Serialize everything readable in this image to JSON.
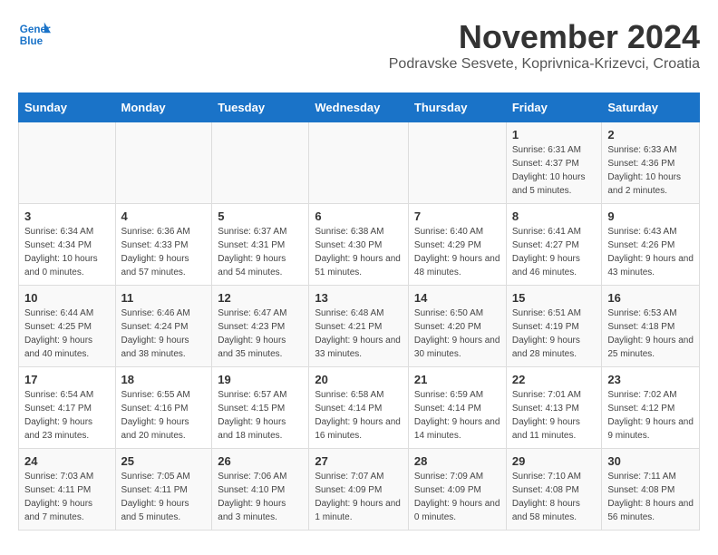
{
  "header": {
    "logo_line1": "General",
    "logo_line2": "Blue",
    "month_title": "November 2024",
    "location": "Podravske Sesvete, Koprivnica-Krizevci, Croatia"
  },
  "weekdays": [
    "Sunday",
    "Monday",
    "Tuesday",
    "Wednesday",
    "Thursday",
    "Friday",
    "Saturday"
  ],
  "weeks": [
    [
      {
        "day": "",
        "info": ""
      },
      {
        "day": "",
        "info": ""
      },
      {
        "day": "",
        "info": ""
      },
      {
        "day": "",
        "info": ""
      },
      {
        "day": "",
        "info": ""
      },
      {
        "day": "1",
        "info": "Sunrise: 6:31 AM\nSunset: 4:37 PM\nDaylight: 10 hours and 5 minutes."
      },
      {
        "day": "2",
        "info": "Sunrise: 6:33 AM\nSunset: 4:36 PM\nDaylight: 10 hours and 2 minutes."
      }
    ],
    [
      {
        "day": "3",
        "info": "Sunrise: 6:34 AM\nSunset: 4:34 PM\nDaylight: 10 hours and 0 minutes."
      },
      {
        "day": "4",
        "info": "Sunrise: 6:36 AM\nSunset: 4:33 PM\nDaylight: 9 hours and 57 minutes."
      },
      {
        "day": "5",
        "info": "Sunrise: 6:37 AM\nSunset: 4:31 PM\nDaylight: 9 hours and 54 minutes."
      },
      {
        "day": "6",
        "info": "Sunrise: 6:38 AM\nSunset: 4:30 PM\nDaylight: 9 hours and 51 minutes."
      },
      {
        "day": "7",
        "info": "Sunrise: 6:40 AM\nSunset: 4:29 PM\nDaylight: 9 hours and 48 minutes."
      },
      {
        "day": "8",
        "info": "Sunrise: 6:41 AM\nSunset: 4:27 PM\nDaylight: 9 hours and 46 minutes."
      },
      {
        "day": "9",
        "info": "Sunrise: 6:43 AM\nSunset: 4:26 PM\nDaylight: 9 hours and 43 minutes."
      }
    ],
    [
      {
        "day": "10",
        "info": "Sunrise: 6:44 AM\nSunset: 4:25 PM\nDaylight: 9 hours and 40 minutes."
      },
      {
        "day": "11",
        "info": "Sunrise: 6:46 AM\nSunset: 4:24 PM\nDaylight: 9 hours and 38 minutes."
      },
      {
        "day": "12",
        "info": "Sunrise: 6:47 AM\nSunset: 4:23 PM\nDaylight: 9 hours and 35 minutes."
      },
      {
        "day": "13",
        "info": "Sunrise: 6:48 AM\nSunset: 4:21 PM\nDaylight: 9 hours and 33 minutes."
      },
      {
        "day": "14",
        "info": "Sunrise: 6:50 AM\nSunset: 4:20 PM\nDaylight: 9 hours and 30 minutes."
      },
      {
        "day": "15",
        "info": "Sunrise: 6:51 AM\nSunset: 4:19 PM\nDaylight: 9 hours and 28 minutes."
      },
      {
        "day": "16",
        "info": "Sunrise: 6:53 AM\nSunset: 4:18 PM\nDaylight: 9 hours and 25 minutes."
      }
    ],
    [
      {
        "day": "17",
        "info": "Sunrise: 6:54 AM\nSunset: 4:17 PM\nDaylight: 9 hours and 23 minutes."
      },
      {
        "day": "18",
        "info": "Sunrise: 6:55 AM\nSunset: 4:16 PM\nDaylight: 9 hours and 20 minutes."
      },
      {
        "day": "19",
        "info": "Sunrise: 6:57 AM\nSunset: 4:15 PM\nDaylight: 9 hours and 18 minutes."
      },
      {
        "day": "20",
        "info": "Sunrise: 6:58 AM\nSunset: 4:14 PM\nDaylight: 9 hours and 16 minutes."
      },
      {
        "day": "21",
        "info": "Sunrise: 6:59 AM\nSunset: 4:14 PM\nDaylight: 9 hours and 14 minutes."
      },
      {
        "day": "22",
        "info": "Sunrise: 7:01 AM\nSunset: 4:13 PM\nDaylight: 9 hours and 11 minutes."
      },
      {
        "day": "23",
        "info": "Sunrise: 7:02 AM\nSunset: 4:12 PM\nDaylight: 9 hours and 9 minutes."
      }
    ],
    [
      {
        "day": "24",
        "info": "Sunrise: 7:03 AM\nSunset: 4:11 PM\nDaylight: 9 hours and 7 minutes."
      },
      {
        "day": "25",
        "info": "Sunrise: 7:05 AM\nSunset: 4:11 PM\nDaylight: 9 hours and 5 minutes."
      },
      {
        "day": "26",
        "info": "Sunrise: 7:06 AM\nSunset: 4:10 PM\nDaylight: 9 hours and 3 minutes."
      },
      {
        "day": "27",
        "info": "Sunrise: 7:07 AM\nSunset: 4:09 PM\nDaylight: 9 hours and 1 minute."
      },
      {
        "day": "28",
        "info": "Sunrise: 7:09 AM\nSunset: 4:09 PM\nDaylight: 9 hours and 0 minutes."
      },
      {
        "day": "29",
        "info": "Sunrise: 7:10 AM\nSunset: 4:08 PM\nDaylight: 8 hours and 58 minutes."
      },
      {
        "day": "30",
        "info": "Sunrise: 7:11 AM\nSunset: 4:08 PM\nDaylight: 8 hours and 56 minutes."
      }
    ]
  ]
}
